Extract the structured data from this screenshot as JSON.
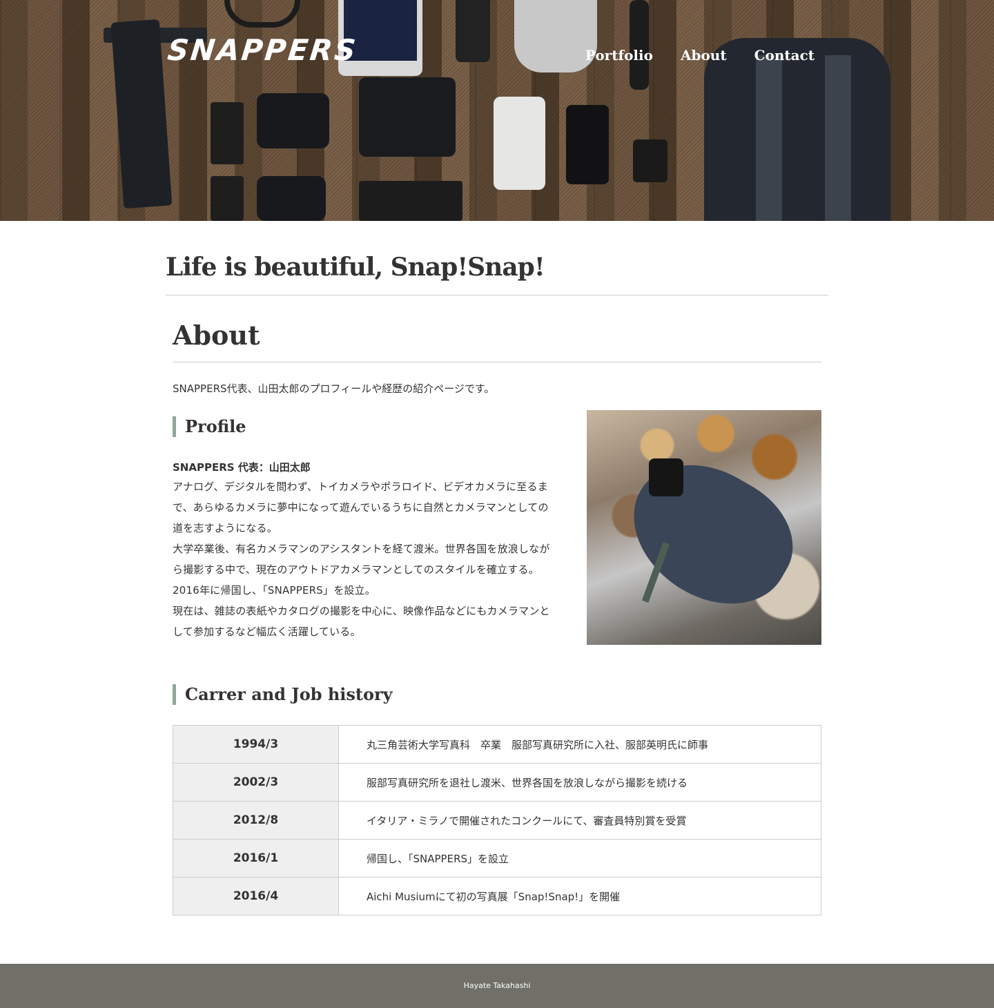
{
  "header": {
    "logo": "SNAPPERS",
    "nav": [
      "Portfolio",
      "About",
      "Contact"
    ]
  },
  "tagline": "Life is beautiful, Snap!Snap!",
  "page": {
    "title": "About",
    "intro": "SNAPPERS代表、山田太郎のプロフィールや経歴の紹介ページです。"
  },
  "profile": {
    "heading": "Profile",
    "name_line": "SNAPPERS 代表：山田太郎",
    "paragraphs": [
      "アナログ、デジタルを問わず、トイカメラやポラロイド、ビデオカメラに至るまで、あらゆるカメラに夢中になって遊んでいるうちに自然とカメラマンとしての道を志すようになる。",
      "大学卒業後、有名カメラマンのアシスタントを経て渡米。世界各国を放浪しながら撮影する中で、現在のアウトドアカメラマンとしてのスタイルを確立する。",
      "2016年に帰国し、「SNAPPERS」を設立。",
      "現在は、雑誌の表紙やカタログの撮影を中心に、映像作品などにもカメラマンとして参加するなど幅広く活躍している。"
    ]
  },
  "career": {
    "heading": "Carrer and Job history",
    "rows": [
      {
        "date": "1994/3",
        "event": "丸三角芸術大学写真科　卒業　服部写真研究所に入社、服部英明氏に師事"
      },
      {
        "date": "2002/3",
        "event": "服部写真研究所を退社し渡米、世界各国を放浪しながら撮影を続ける"
      },
      {
        "date": "2012/8",
        "event": "イタリア・ミラノで開催されたコンクールにて、審査員特別賞を受賞"
      },
      {
        "date": "2016/1",
        "event": "帰国し、「SNAPPERS」を設立"
      },
      {
        "date": "2016/4",
        "event": "Aichi Musiumにて初の写真展「Snap!Snap!」を開催"
      }
    ]
  },
  "footer": {
    "credit": "Hayate Takahashi"
  },
  "colors": {
    "heading_accent": "#8fa899",
    "table_year_bg": "#efefef",
    "footer_bg": "#707069"
  }
}
